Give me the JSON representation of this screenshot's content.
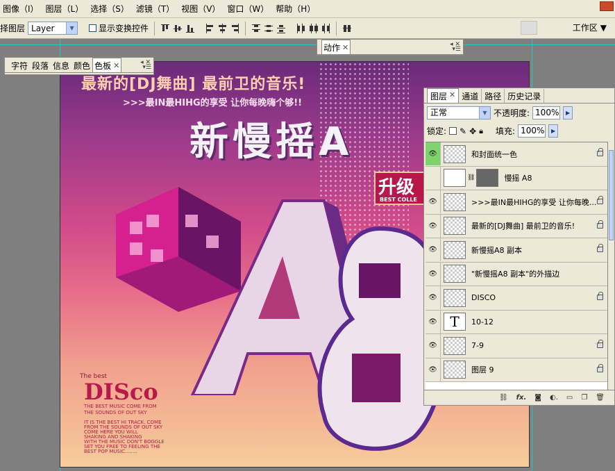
{
  "menubar": {
    "items": [
      "图像（I）",
      "图层（L）",
      "选择（S）",
      "滤镜（T）",
      "视图（V）",
      "窗口（W）",
      "帮助（H）"
    ]
  },
  "options": {
    "auto_select_label": "择图层",
    "auto_select_value": "Layer",
    "show_transform_label": "显示变换控件",
    "workspace_label": "工作区"
  },
  "panels": {
    "chars": {
      "tabs": [
        "字符",
        "段落",
        "信息",
        "颜色",
        "色板"
      ],
      "active": "色板"
    },
    "actions": {
      "tab": "动作"
    }
  },
  "artwork": {
    "line1": "最新的[DJ舞曲] 最前卫的音乐!",
    "line2": ">>>最IN最HIHG的享受  让你每晚嗨个够!!",
    "title": "新慢摇A",
    "badge_main": "升级",
    "badge_sub": "BEST COLLE",
    "disco_small": "The best",
    "disco": "DISco",
    "disco_lines": [
      "THE BEST MUSIC COME FROM",
      "THE SOUNDS OF OUT SKY",
      "IT IS THE BEST HI TRACK. COME",
      "FROM THE SOUNDS OF OUT SKY",
      "COME HERE YOU WILL",
      "SHAKING AND SHAKING",
      "WITH THE MUSIC DON'T BOGGLE",
      "SET YOU FREE TO FEELING THE",
      "BEST POP MUSIC........"
    ]
  },
  "layers_panel": {
    "tabs": [
      "图层",
      "通道",
      "路径",
      "历史记录"
    ],
    "active_tab": "图层",
    "blend_mode": "正常",
    "opacity_label": "不透明度:",
    "opacity_value": "100%",
    "lock_label": "锁定:",
    "fill_label": "填充:",
    "fill_value": "100%",
    "layers": [
      {
        "name": "和封面统一色",
        "visible": true,
        "highlight": true,
        "locked": true,
        "thumb": "checker"
      },
      {
        "name": "慢摇 A8",
        "visible": false,
        "highlight": false,
        "locked": false,
        "thumb": "mask"
      },
      {
        "name": ">>>最IN最HIHG的享受 让你每晚...",
        "visible": true,
        "highlight": false,
        "locked": true,
        "thumb": "checker"
      },
      {
        "name": "最新的[DJ舞曲] 最前卫的音乐!",
        "visible": true,
        "highlight": false,
        "locked": true,
        "thumb": "checker"
      },
      {
        "name": "新慢摇A8 副本",
        "visible": true,
        "highlight": false,
        "locked": true,
        "thumb": "checker"
      },
      {
        "name": "\"新慢摇A8 副本\"的外描边",
        "visible": true,
        "highlight": false,
        "locked": false,
        "thumb": "checker"
      },
      {
        "name": "DISCO",
        "visible": true,
        "highlight": false,
        "locked": true,
        "thumb": "checker"
      },
      {
        "name": "10-12",
        "visible": true,
        "highlight": false,
        "locked": false,
        "thumb": "text"
      },
      {
        "name": "7-9",
        "visible": true,
        "highlight": false,
        "locked": true,
        "thumb": "checker"
      },
      {
        "name": "图层 9",
        "visible": true,
        "highlight": false,
        "locked": true,
        "thumb": "checker"
      }
    ],
    "footer_icons": [
      "link-icon",
      "fx-icon",
      "mask-icon",
      "adjustment-icon",
      "group-icon",
      "new-layer-icon",
      "trash-icon"
    ]
  }
}
